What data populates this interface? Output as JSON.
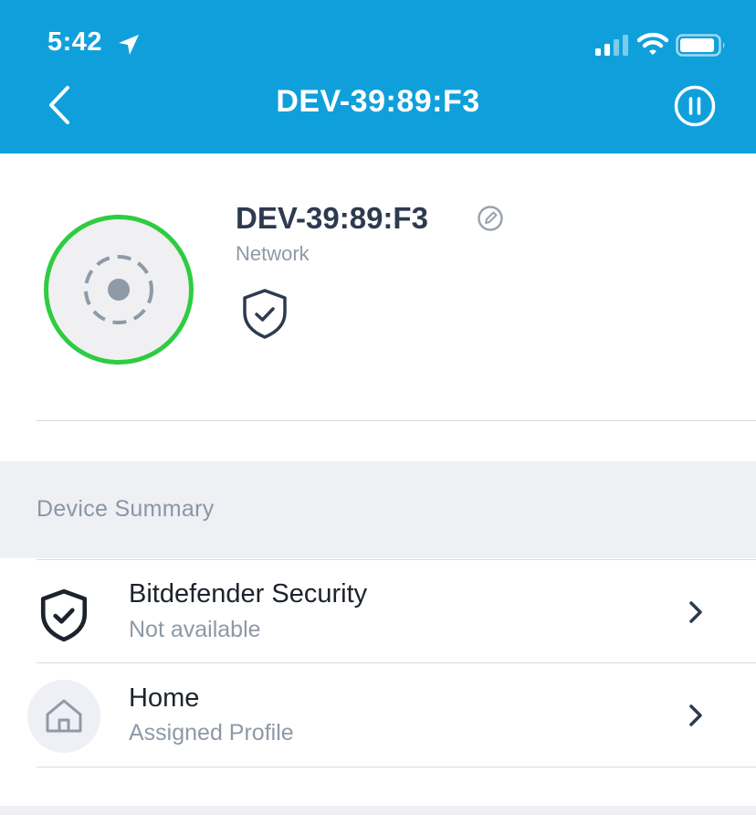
{
  "status_bar": {
    "time": "5:42",
    "icons": [
      "location-arrow-icon",
      "cellular-signal-icon",
      "wifi-icon",
      "battery-icon"
    ]
  },
  "header": {
    "title": "DEV-39:89:F3",
    "back_icon": "chevron-left-icon",
    "pause_icon": "pause-circle-icon",
    "background_color": "#0fa0dc"
  },
  "device": {
    "name": "DEV-39:89:F3",
    "type": "Network",
    "status_ring_color": "#2ecc40",
    "icons": [
      "device-generic-icon",
      "edit-pencil-icon",
      "shield-check-icon"
    ]
  },
  "summary": {
    "section_title": "Device Summary",
    "rows": [
      {
        "title": "Bitdefender Security",
        "subtitle": "Not available",
        "icon": "shield-check-icon"
      },
      {
        "title": "Home",
        "subtitle": "Assigned Profile",
        "icon": "home-icon"
      }
    ]
  }
}
